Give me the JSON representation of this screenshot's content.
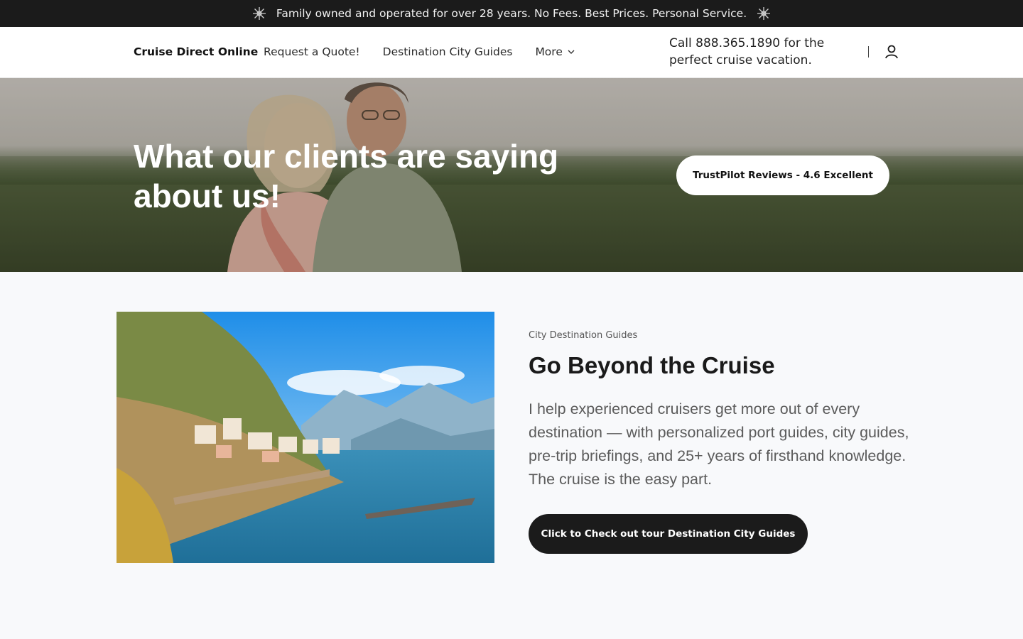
{
  "announcement": {
    "text": "Family owned and operated for over 28 years. No Fees. Best Prices. Personal Service.",
    "icon": "snowflake-icon"
  },
  "header": {
    "brand": "Cruise Direct Online",
    "nav": [
      {
        "label": "Request a Quote!"
      },
      {
        "label": "Destination City Guides"
      },
      {
        "label": "More"
      }
    ],
    "phone_line1": "Call 888.365.1890 for the",
    "phone_line2": "perfect cruise vacation.",
    "account_icon": "user-icon"
  },
  "hero": {
    "title": "What our clients are saying about us!",
    "button_label": "TrustPilot Reviews - 4.6 Excellent"
  },
  "feature": {
    "eyebrow": "City Destination Guides",
    "title": "Go Beyond the Cruise",
    "body": "I help experienced cruisers get more out of every destination — with personalized port guides, city guides, pre-trip briefings, and 25+ years of firsthand knowledge. The cruise is the easy part.",
    "button_label": "Click to Check out tour Destination City Guides"
  },
  "colors": {
    "announcement_bg": "#1b1b1b",
    "header_bg": "#ffffff",
    "page_bg": "#f8f9fb",
    "button_dark": "#1b1b1b",
    "button_light": "#ffffff"
  }
}
